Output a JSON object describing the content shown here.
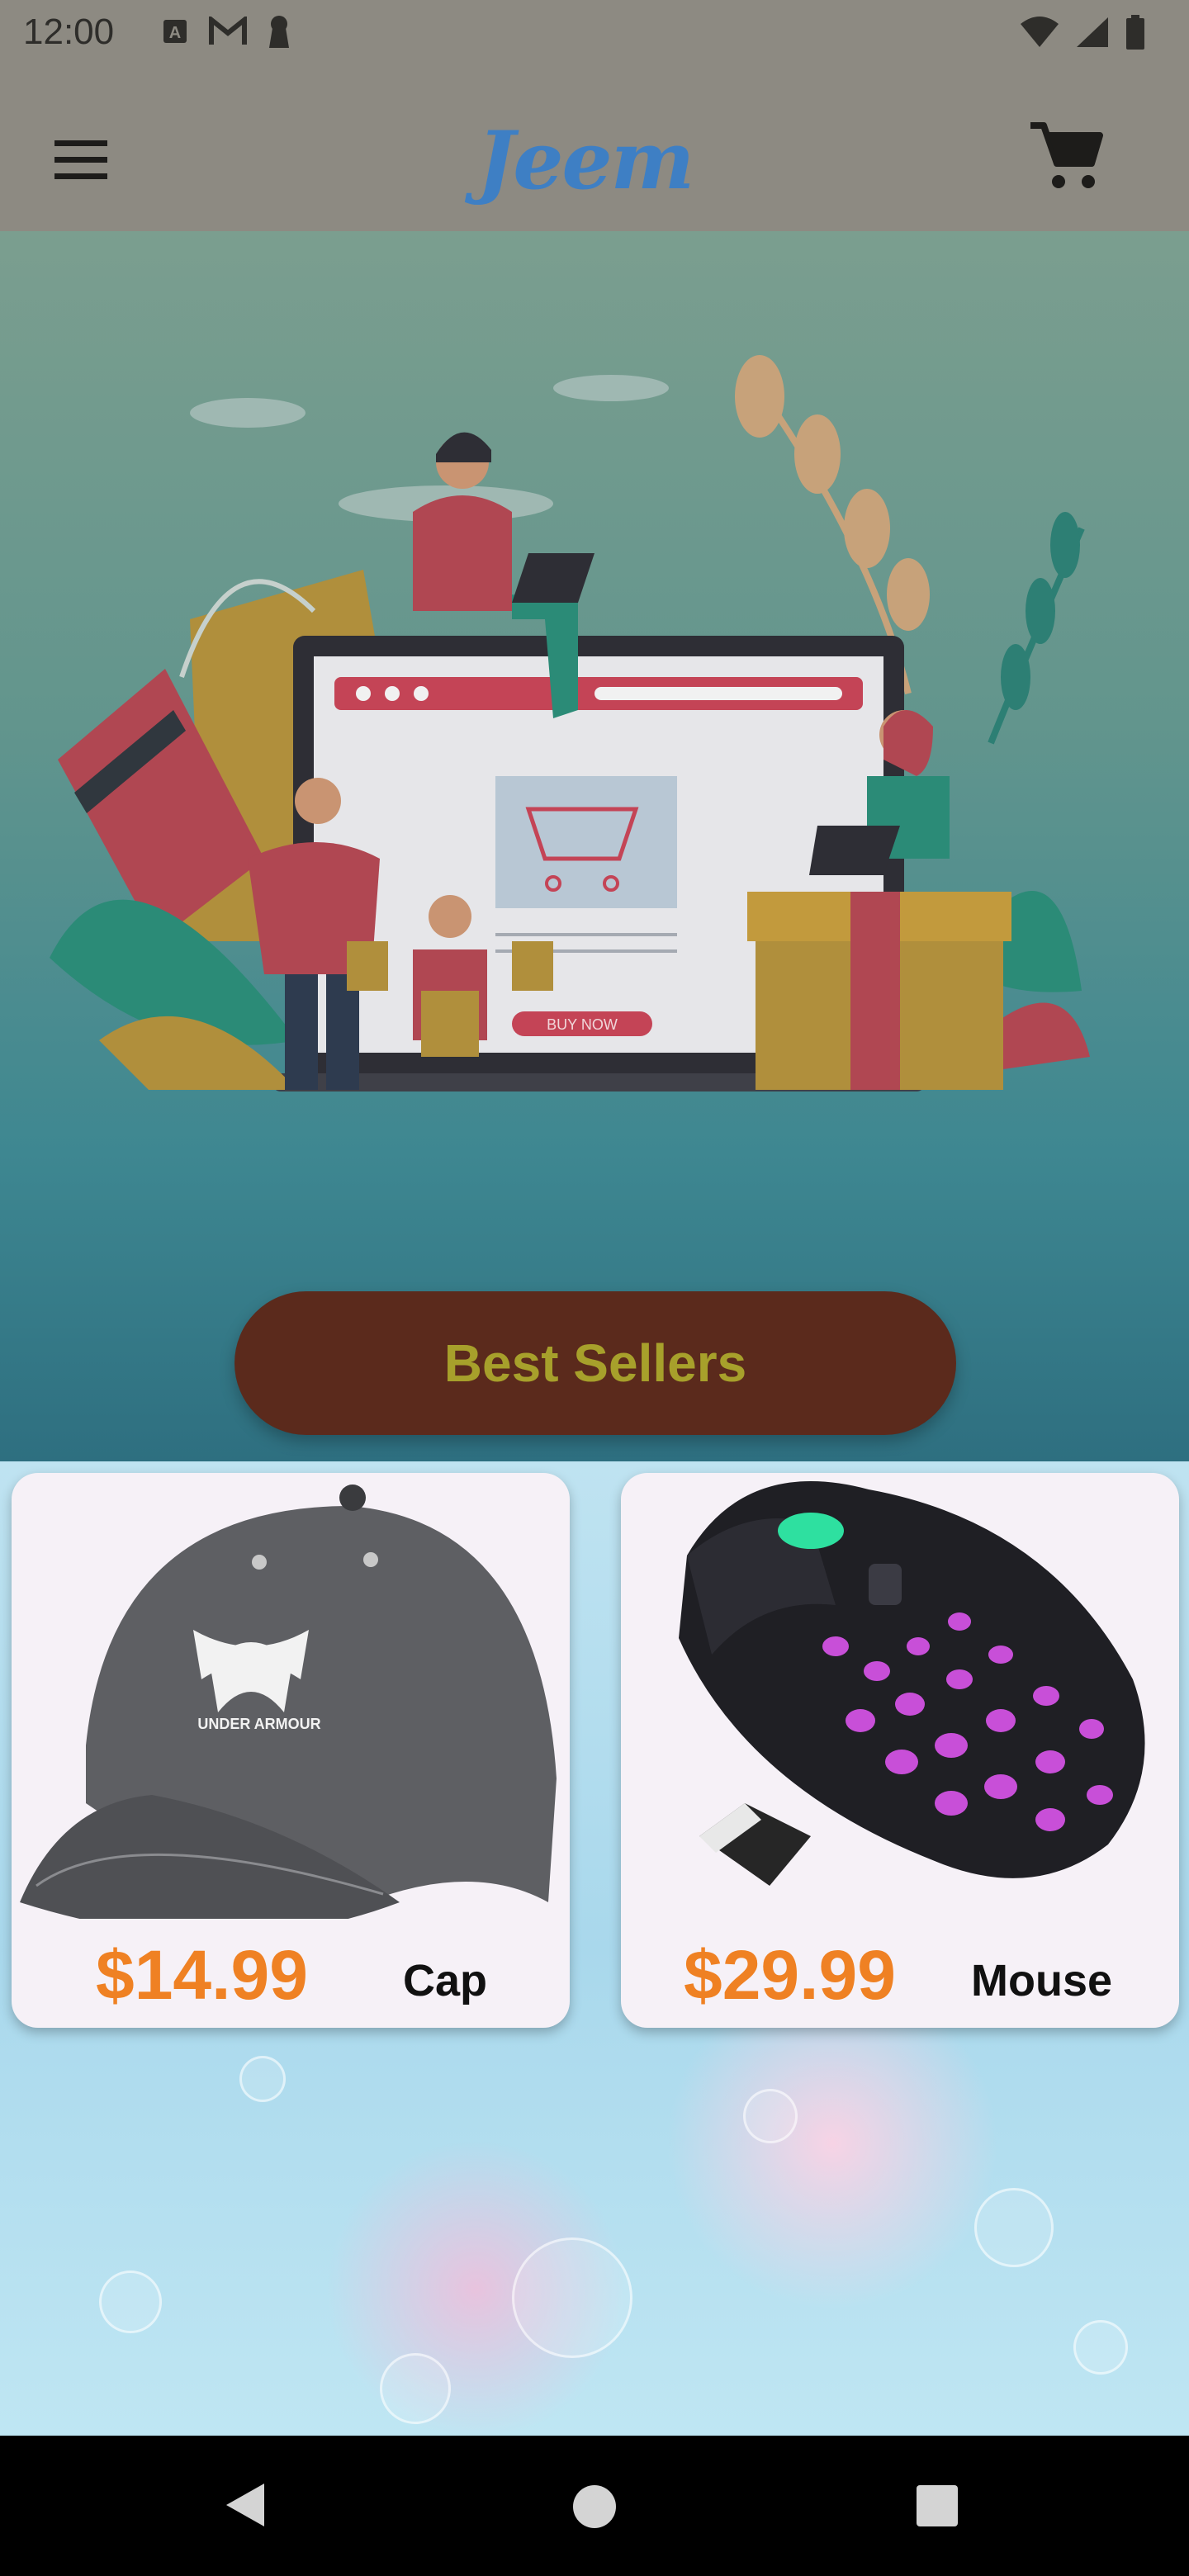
{
  "status_bar": {
    "time": "12:00"
  },
  "app_bar": {
    "logo_text": "Jeem"
  },
  "hero": {
    "button_label": "Best Sellers",
    "illustration_text": "BUY NOW"
  },
  "products": [
    {
      "price": "$14.99",
      "name": "Cap",
      "brand_text": "UNDER ARMOUR"
    },
    {
      "price": "$29.99",
      "name": "Mouse"
    }
  ],
  "colors": {
    "logo": "#3e7fc4",
    "price": "#ef8123",
    "button_bg": "#5b2a1c",
    "button_text": "#a7a02b"
  }
}
